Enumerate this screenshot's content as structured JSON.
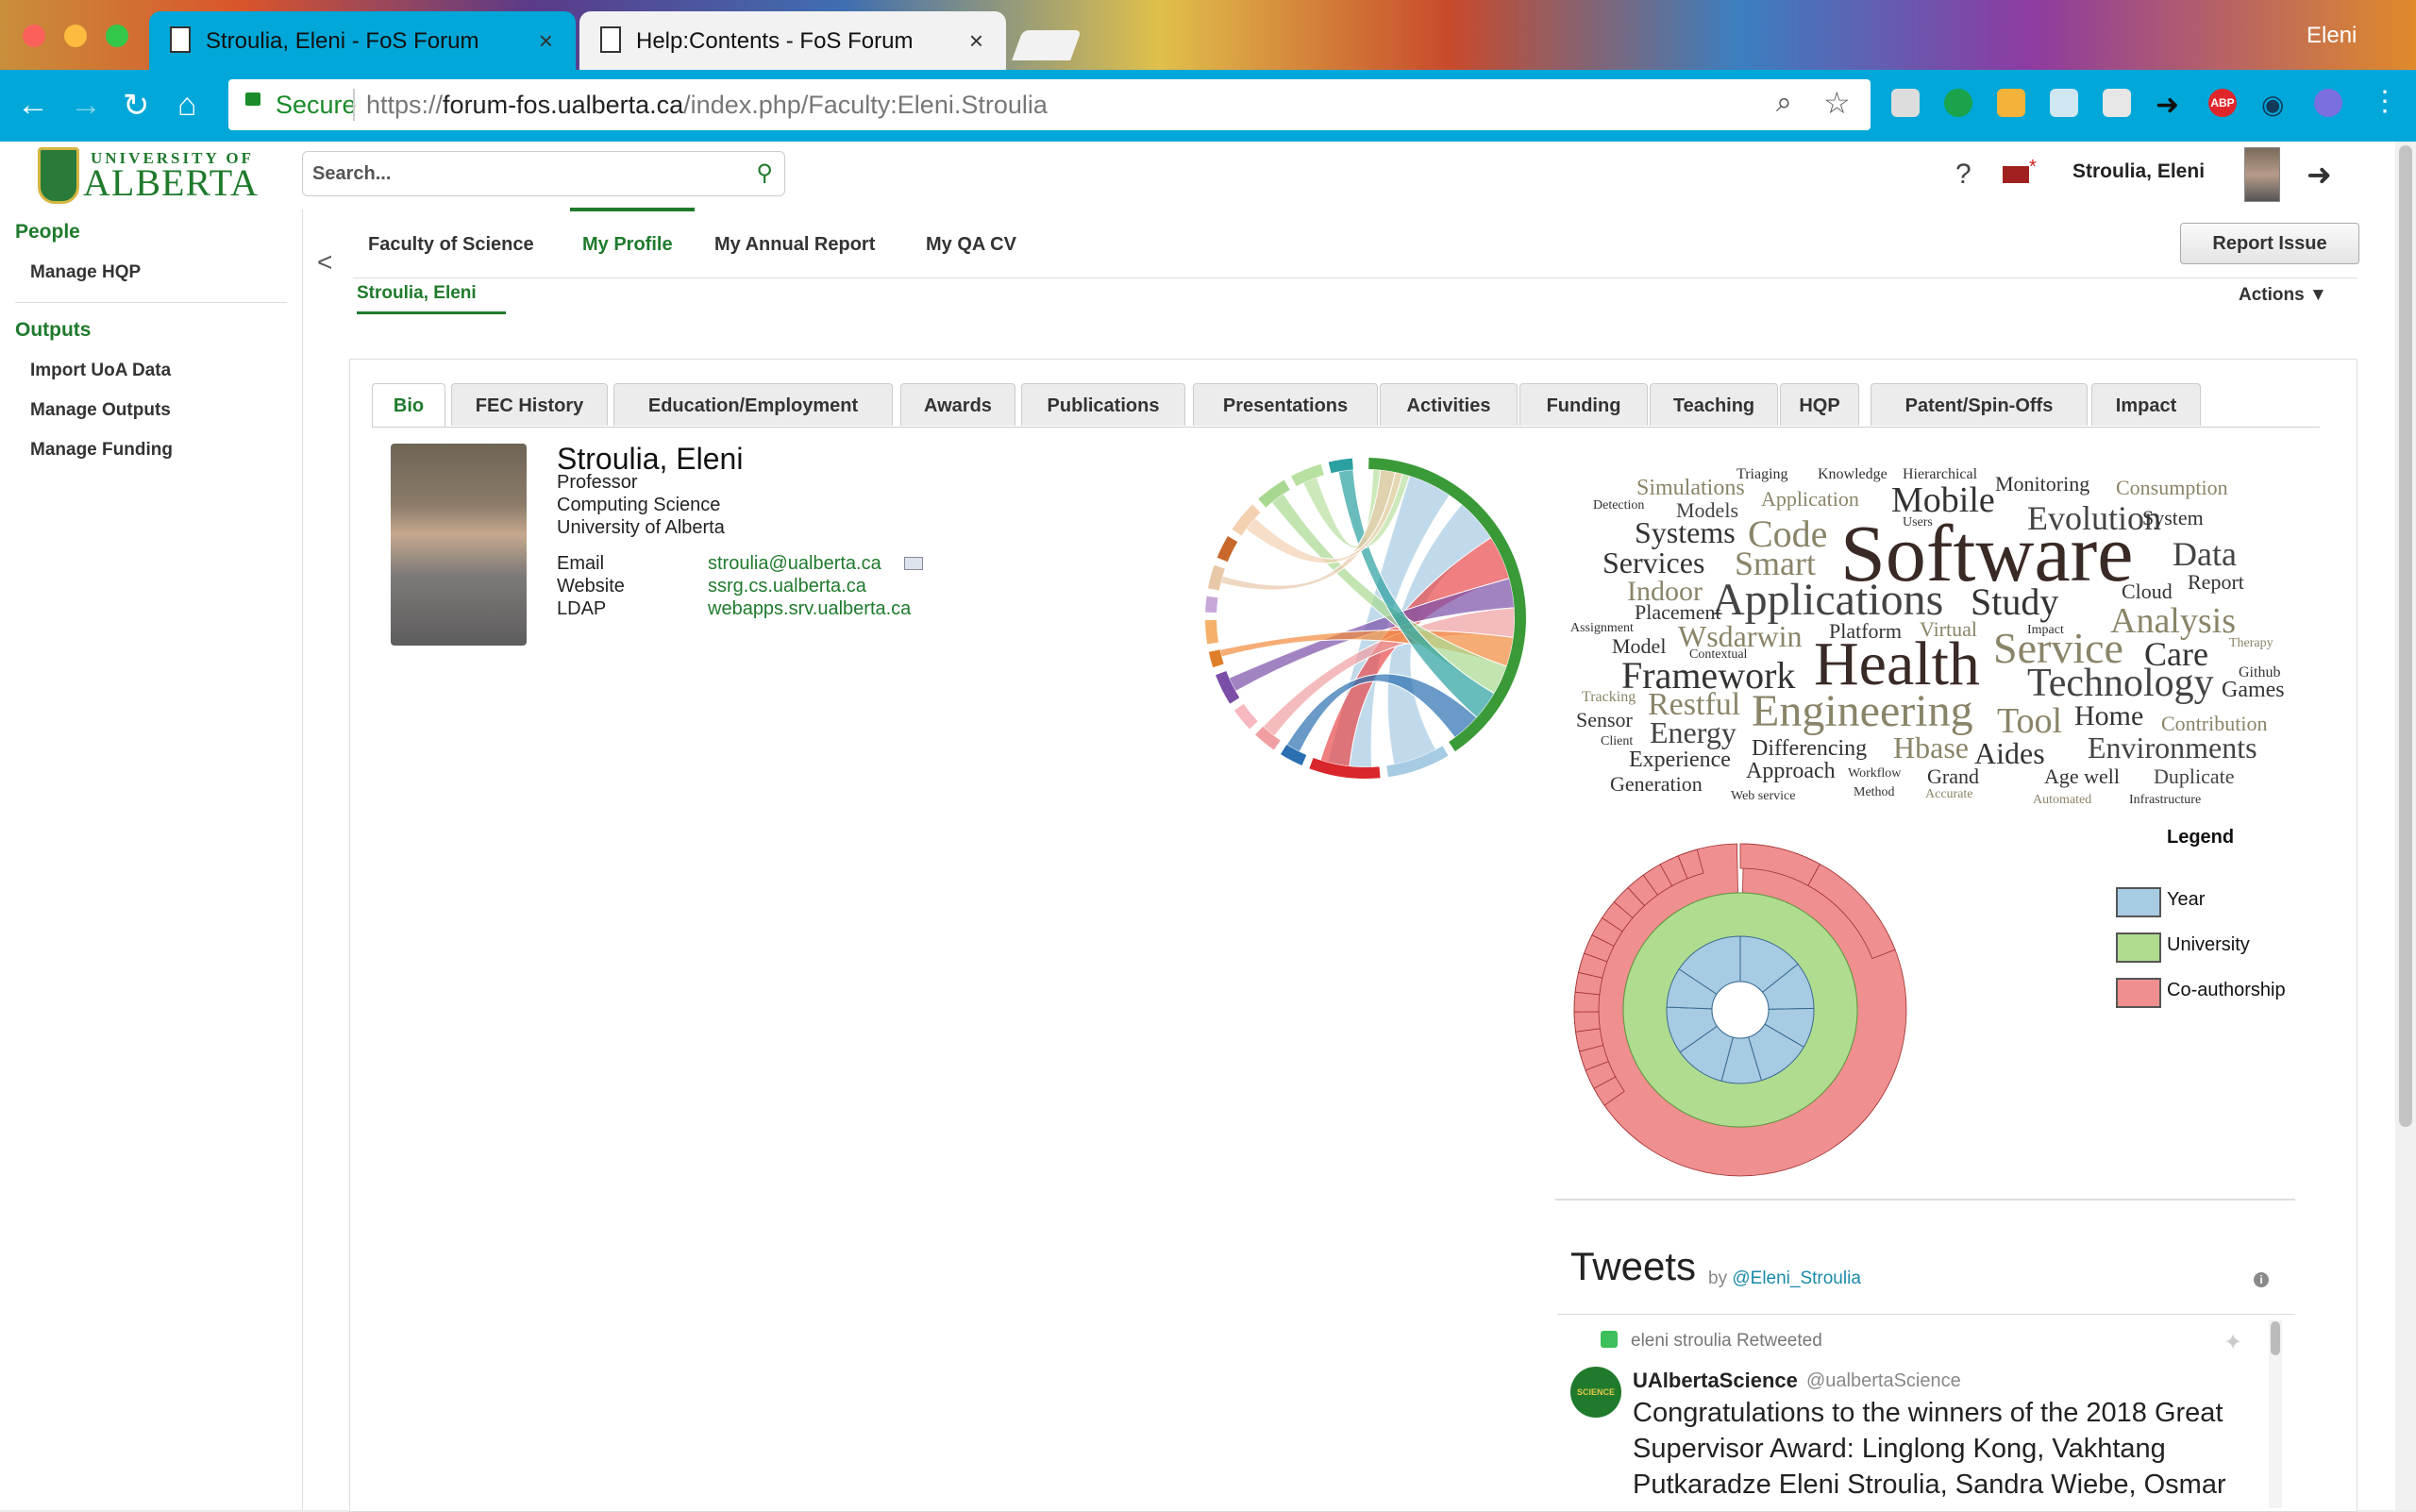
{
  "browser": {
    "tabs": [
      {
        "title": "Stroulia, Eleni - FoS Forum",
        "close": "×"
      },
      {
        "title": "Help:Contents - FoS Forum",
        "close": "×"
      }
    ],
    "profile_name": "Eleni",
    "secure_label": "Secure",
    "url_scheme": "https://",
    "url_host": "forum-fos.ualberta.ca",
    "url_path": "/index.php/Faculty:Eleni.Stroulia",
    "extensions": [
      "evernote-icon",
      "hangouts-icon",
      "feed-icon",
      "cast-icon",
      "drive-icon",
      "share-icon",
      "adblock-icon",
      "eye-icon",
      "shield-icon"
    ],
    "adblock_label": "ABP"
  },
  "header": {
    "logo_top": "UNIVERSITY OF",
    "logo_main": "ALBERTA",
    "search_placeholder": "Search...",
    "help": "?",
    "mail_star": "*",
    "user_name": "Stroulia, Eleni"
  },
  "sidebar": {
    "sections": [
      {
        "heading": "People",
        "items": [
          "Manage HQP"
        ]
      },
      {
        "heading": "Outputs",
        "items": [
          "Import UoA Data",
          "Manage Outputs",
          "Manage Funding"
        ]
      }
    ]
  },
  "topnav": {
    "collapse": "<",
    "items": [
      "Faculty of Science",
      "My Profile",
      "My Annual Report",
      "My QA CV"
    ],
    "active": "My Profile",
    "sub": "Stroulia, Eleni",
    "report_issue": "Report Issue",
    "actions": "Actions ▼"
  },
  "profile_tabs": [
    "Bio",
    "FEC History",
    "Education/Employment",
    "Awards",
    "Publications",
    "Presentations",
    "Activities",
    "Funding",
    "Teaching",
    "HQP",
    "Patent/Spin-Offs",
    "Impact"
  ],
  "profile": {
    "name": "Stroulia, Eleni",
    "title": "Professor",
    "department": "Computing Science",
    "university": "University of Alberta",
    "contacts": [
      {
        "label": "Email",
        "value": "stroulia@ualberta.ca"
      },
      {
        "label": "Website",
        "value": "ssrg.cs.ualberta.ca"
      },
      {
        "label": "LDAP",
        "value": "webapps.srv.ualberta.ca"
      }
    ]
  },
  "wordcloud": [
    {
      "t": "Triaging"
    },
    {
      "t": "Knowledge"
    },
    {
      "t": "Hierarchical"
    },
    {
      "t": "Simulations"
    },
    {
      "t": "Monitoring"
    },
    {
      "t": "Consumption"
    },
    {
      "t": "Detection"
    },
    {
      "t": "Models"
    },
    {
      "t": "Application"
    },
    {
      "t": "Mobile"
    },
    {
      "t": "Evolution"
    },
    {
      "t": "System"
    },
    {
      "t": "Systems"
    },
    {
      "t": "Code"
    },
    {
      "t": "Users"
    },
    {
      "t": "Software"
    },
    {
      "t": "Services"
    },
    {
      "t": "Smart"
    },
    {
      "t": "Data"
    },
    {
      "t": "Indoor"
    },
    {
      "t": "Applications"
    },
    {
      "t": "Study"
    },
    {
      "t": "Cloud"
    },
    {
      "t": "Report"
    },
    {
      "t": "Placement"
    },
    {
      "t": "Assignment"
    },
    {
      "t": "Analysis"
    },
    {
      "t": "Wsdarwin"
    },
    {
      "t": "Platform"
    },
    {
      "t": "Virtual"
    },
    {
      "t": "Impact"
    },
    {
      "t": "Model"
    },
    {
      "t": "Contextual"
    },
    {
      "t": "Service"
    },
    {
      "t": "Care"
    },
    {
      "t": "Therapy"
    },
    {
      "t": "Framework"
    },
    {
      "t": "Health"
    },
    {
      "t": "Github"
    },
    {
      "t": "Technology"
    },
    {
      "t": "Tracking"
    },
    {
      "t": "Restful"
    },
    {
      "t": "Games"
    },
    {
      "t": "Sensor"
    },
    {
      "t": "Engineering"
    },
    {
      "t": "Tool"
    },
    {
      "t": "Home"
    },
    {
      "t": "Contribution"
    },
    {
      "t": "Client"
    },
    {
      "t": "Energy"
    },
    {
      "t": "Differencing"
    },
    {
      "t": "Hbase"
    },
    {
      "t": "Aides"
    },
    {
      "t": "Environments"
    },
    {
      "t": "Experience"
    },
    {
      "t": "Approach"
    },
    {
      "t": "Workflow"
    },
    {
      "t": "Grand"
    },
    {
      "t": "Age well"
    },
    {
      "t": "Duplicate"
    },
    {
      "t": "Generation"
    },
    {
      "t": "Web service"
    },
    {
      "t": "Method"
    },
    {
      "t": "Accurate"
    },
    {
      "t": "Automated"
    },
    {
      "t": "Infrastructure"
    }
  ],
  "legend": {
    "title": "Legend",
    "items": [
      {
        "label": "Year",
        "color": "#a6cbe3"
      },
      {
        "label": "University",
        "color": "#b0dc8f"
      },
      {
        "label": "Co-authorship",
        "color": "#ef8f8f"
      }
    ]
  },
  "tweets": {
    "title": "Tweets",
    "by": "by",
    "handle": "@Eleni_Stroulia",
    "info": "i",
    "retweet_note": "eleni stroulia Retweeted",
    "author": "UAlbertaScience",
    "author_handle": "@ualbertaScience",
    "avatar_text": "SCIENCE",
    "text": "Congratulations to the winners of the 2018 Great Supervisor Award:  Linglong Kong, Vakhtang Putkaradze Eleni Stroulia, Sandra Wiebe, Osmar"
  }
}
